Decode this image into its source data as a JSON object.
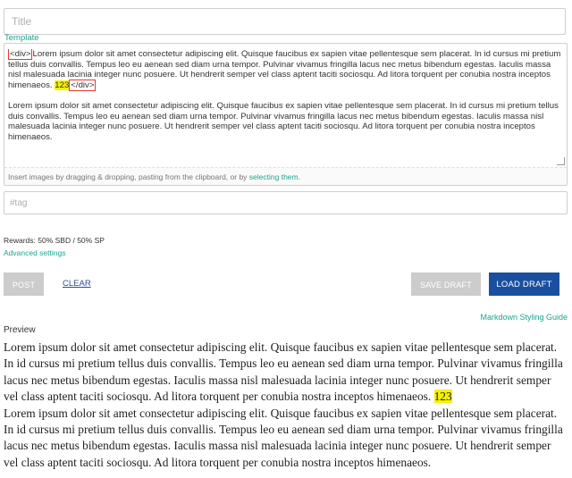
{
  "title_field": {
    "placeholder": "Title",
    "value": ""
  },
  "template_link": "Template",
  "editor": {
    "line1_tag_open": "<div>",
    "line1_text": "Lorem ipsum dolor sit amet consectetur adipiscing elit. Quisque faucibus ex sapien vitae pellentesque sem placerat. In id cursus mi pretium tellus duis convallis. Tempus leo eu aenean sed diam urna tempor. Pulvinar vivamus fringilla lacus nec metus bibendum egestas. Iaculis massa nisl malesuada lacinia integer nunc posuere. Ut hendrerit semper vel class aptent taciti sociosqu. Ad litora torquent per conubia nostra inceptos himenaeos.",
    "line1_highlight": "123",
    "line1_tag_close": "</div>",
    "paragraph2": "Lorem ipsum dolor sit amet consectetur adipiscing elit. Quisque faucibus ex sapien vitae pellentesque sem placerat. In id cursus mi pretium tellus duis convallis. Tempus leo eu aenean sed diam urna tempor. Pulvinar vivamus fringilla lacus nec metus bibendum egestas. Iaculis massa nisl malesuada lacinia integer nunc posuere. Ut hendrerit semper vel class aptent taciti sociosqu. Ad litora torquent per conubia nostra inceptos himenaeos.",
    "hint_text": "Insert images by dragging & dropping, pasting from the clipboard, or by ",
    "hint_link": "selecting them",
    "hint_end": "."
  },
  "tag_field": {
    "placeholder": "#tag",
    "value": ""
  },
  "rewards": "Rewards: 50% SBD / 50% SP",
  "advanced_settings": "Advanced settings",
  "buttons": {
    "post": "POST",
    "clear": "CLEAR",
    "save_draft": "SAVE DRAFT",
    "load_draft": "LOAD DRAFT"
  },
  "markdown_guide": "Markdown Styling Guide",
  "preview": {
    "label": "Preview",
    "para1_text": "Lorem ipsum dolor sit amet consectetur adipiscing elit. Quisque faucibus ex sapien vitae pellentesque sem placerat. In id cursus mi pretium tellus duis convallis. Tempus leo eu aenean sed diam urna tempor. Pulvinar vivamus fringilla lacus nec metus bibendum egestas. Iaculis massa nisl malesuada lacinia integer nunc posuere. Ut hendrerit semper vel class aptent taciti sociosqu. Ad litora torquent per conubia nostra inceptos himenaeos.",
    "para1_highlight": "123",
    "para2": "Lorem ipsum dolor sit amet consectetur adipiscing elit. Quisque faucibus ex sapien vitae pellentesque sem placerat. In id cursus mi pretium tellus duis convallis. Tempus leo eu aenean sed diam urna tempor. Pulvinar vivamus fringilla lacus nec metus bibendum egestas. Iaculis massa nisl malesuada lacinia integer nunc posuere. Ut hendrerit semper vel class aptent taciti sociosqu. Ad litora torquent per conubia nostra inceptos himenaeos."
  },
  "colors": {
    "accent_green": "#1aa58e",
    "primary_blue": "#1a4fa0",
    "disabled_gray": "#cccccc",
    "highlight_yellow": "#f5f200",
    "annotation_red": "#e53935"
  }
}
